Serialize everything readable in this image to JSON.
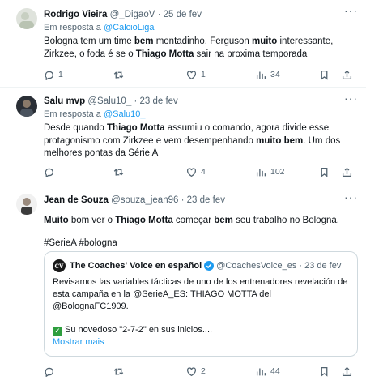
{
  "tweets": [
    {
      "name": "Rodrigo Vieira",
      "handle": "@_DigaoV",
      "sep": "·",
      "date": "25 de fev",
      "reply_prefix": "Em resposta a",
      "reply_to": "@CalcioLiga",
      "text_parts": [
        "Bologna tem um time ",
        "bem",
        " montadinho, Ferguson ",
        "muito",
        " interessante, Zirkzee, o foda é se o ",
        "Thiago Motta",
        " sair na proxima temporada"
      ],
      "replies": "1",
      "retweets": "",
      "likes": "1",
      "views": "34"
    },
    {
      "name": "Salu mvp",
      "handle": "@Salu10_",
      "sep": "·",
      "date": "23 de fev",
      "reply_prefix": "Em resposta a",
      "reply_to": "@Salu10_",
      "text_parts": [
        "Desde quando ",
        "Thiago Motta",
        " assumiu o comando, agora divide esse protagonismo com Zirkzee e vem desempenhando ",
        "muito bem",
        ". Um dos melhores pontas da Série A"
      ],
      "replies": "",
      "retweets": "",
      "likes": "4",
      "views": "102"
    },
    {
      "name": "Jean de Souza",
      "handle": "@souza_jean96",
      "sep": "·",
      "date": "23 de fev",
      "text_parts": [
        "Muito",
        " bom ver o ",
        "Thiago Motta",
        " começar ",
        "bem",
        " seu trabalho no Bologna."
      ],
      "hashtags": "#SerieA #bologna",
      "replies": "",
      "retweets": "",
      "likes": "2",
      "views": "44",
      "quote": {
        "avatar_text": "CV",
        "name": "The Coaches' Voice en español",
        "handle": "@CoachesVoice_es",
        "sep": "·",
        "date": "23 de fev",
        "text": "Revisamos las variables tácticas de uno de los entrenadores revelación de esta campaña en la @SerieA_ES: THIAGO MOTTA del @BolognaFC1909.",
        "text2": "Su novedoso \"2-7-2\" en sus inicios....",
        "show_more": "Mostrar mais"
      }
    }
  ],
  "colors": {
    "accent": "#1d9bf0",
    "muted": "#536471",
    "border": "#cfd9de",
    "check": "#2e9e3e"
  },
  "icons": [
    "more-icon",
    "reply-icon",
    "retweet-icon",
    "like-icon",
    "views-icon",
    "bookmark-icon",
    "share-icon",
    "verified-icon",
    "check-emoji-icon"
  ]
}
